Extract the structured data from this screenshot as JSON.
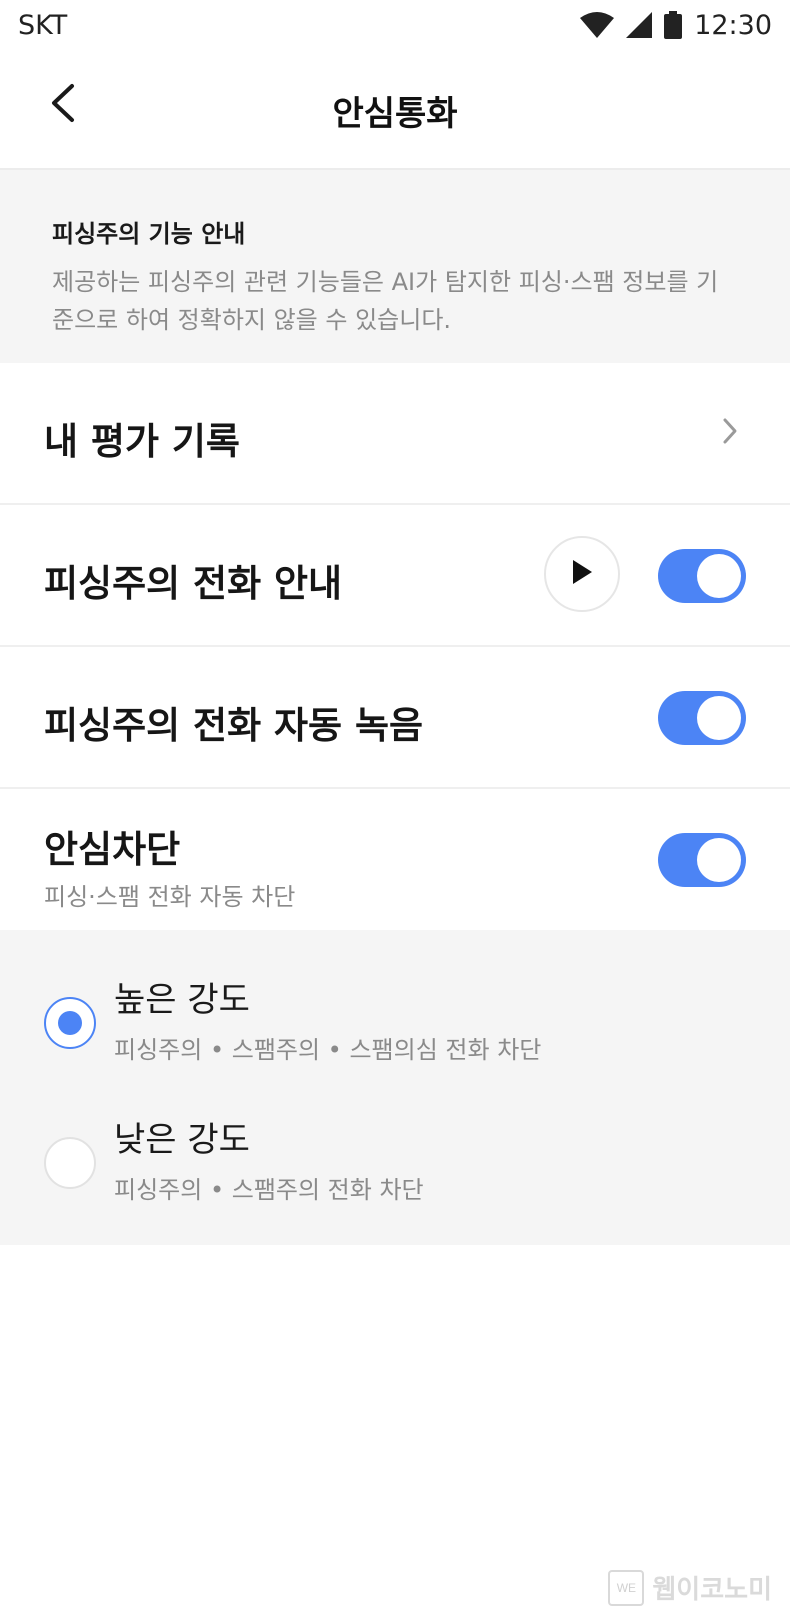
{
  "status_bar": {
    "carrier": "SKT",
    "time": "12:30",
    "icons": [
      "wifi-icon",
      "signal-icon",
      "battery-icon"
    ]
  },
  "header": {
    "title": "안심통화",
    "back_icon": "chevron-left-icon"
  },
  "notice": {
    "title": "피싱주의 기능 안내",
    "description": "제공하는 피싱주의 관련 기능들은 AI가 탐지한 피싱·스팸 정보를 기준으로 하여 정확하지 않을 수 있습니다."
  },
  "rows": {
    "rating_history": {
      "label": "내 평가 기록",
      "icon": "chevron-right-icon"
    },
    "phishing_guide": {
      "label": "피싱주의 전화 안내",
      "toggle_on": true,
      "play_icon": "play-icon"
    },
    "auto_record": {
      "label": "피싱주의 전화 자동 녹음",
      "toggle_on": true
    },
    "safe_block": {
      "label": "안심차단",
      "sub": "피싱·스팸 전화 자동 차단",
      "toggle_on": true
    }
  },
  "block_options": [
    {
      "label": "높은 강도",
      "desc": "피싱주의 • 스팸주의 • 스팸의심 전화 차단",
      "selected": true
    },
    {
      "label": "낮은 강도",
      "desc": "피싱주의 • 스팸주의 전화 차단",
      "selected": false
    }
  ],
  "watermark": {
    "logo": "WE",
    "text": "웹이코노미"
  },
  "colors": {
    "accent": "#4c84f5",
    "section_bg": "#f5f5f5",
    "secondary_text": "#8a8a8a"
  }
}
